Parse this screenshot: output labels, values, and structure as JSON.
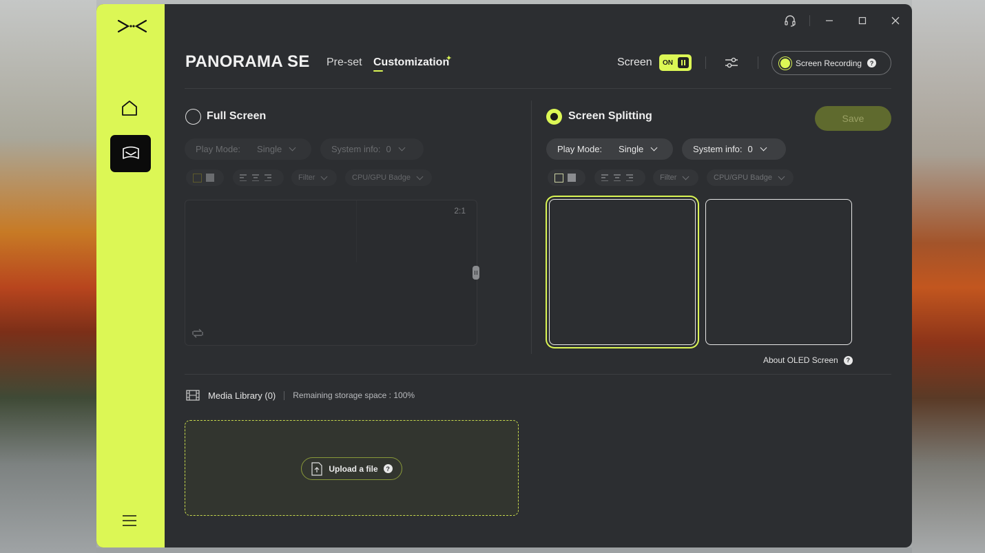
{
  "app": {
    "product_title": "PANORAMA SE",
    "tabs": [
      {
        "label": "Pre-set",
        "active": false
      },
      {
        "label": "Customization",
        "active": true
      }
    ]
  },
  "colors": {
    "accent": "#dcf755",
    "window_bg": "#2c2e31",
    "save_bg": "#5f6a2e"
  },
  "header": {
    "screen_label": "Screen",
    "screen_toggle": "ON",
    "recording_label": "Screen Recording",
    "help_glyph": "?"
  },
  "full_screen": {
    "title": "Full Screen",
    "selected": false,
    "play_mode_label": "Play Mode:",
    "play_mode_value": "Single",
    "system_info_label": "System info:",
    "system_info_value": "0",
    "filter_label": "Filter",
    "badge_label": "CPU/GPU Badge",
    "ratio": "2:1"
  },
  "screen_splitting": {
    "title": "Screen Splitting",
    "selected": true,
    "save_label": "Save",
    "play_mode_label": "Play Mode:",
    "play_mode_value": "Single",
    "system_info_label": "System info:",
    "system_info_value": "0",
    "filter_label": "Filter",
    "badge_label": "CPU/GPU Badge",
    "about_label": "About OLED Screen"
  },
  "media": {
    "library_label": "Media Library (0)",
    "storage_label": "Remaining storage space : 100%",
    "upload_label": "Upload a file"
  }
}
